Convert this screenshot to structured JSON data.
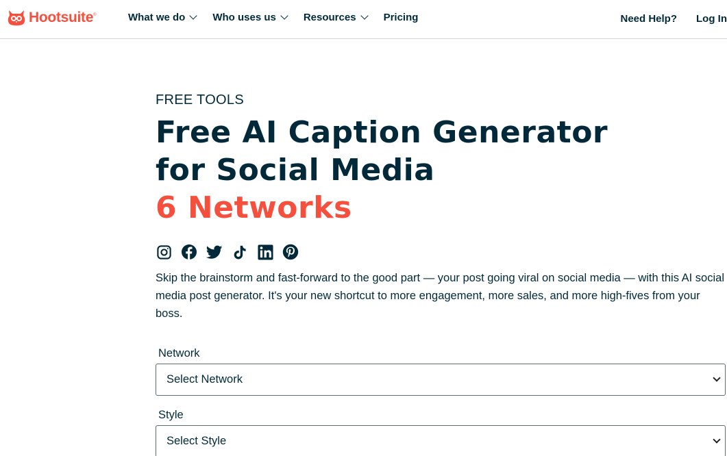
{
  "brand": {
    "name": "Hootsuite",
    "trademark": "®",
    "color": "#f4503d"
  },
  "nav": {
    "items": [
      {
        "label": "What we do",
        "has_dropdown": true
      },
      {
        "label": "Who uses us",
        "has_dropdown": true
      },
      {
        "label": "Resources",
        "has_dropdown": true
      },
      {
        "label": "Pricing",
        "has_dropdown": false
      }
    ],
    "help_label": "Need Help?",
    "login_label": "Log In"
  },
  "hero": {
    "eyebrow": "FREE TOOLS",
    "title_line1": "Free AI Caption Generator",
    "title_line2": "for Social Media",
    "title_accent": "6 Networks",
    "accent_color": "#f4503d",
    "text_color": "#012939",
    "social_icons": [
      "instagram-icon",
      "facebook-icon",
      "twitter-icon",
      "tiktok-icon",
      "linkedin-icon",
      "pinterest-icon"
    ],
    "intro": "Skip the brainstorm and fast-forward to the good part — your post going viral on social media — with this AI social media post generator. It's your new shortcut to more engagement, more sales, and more high-fives from your boss."
  },
  "form": {
    "network": {
      "label": "Network",
      "selected": "Select Network"
    },
    "style": {
      "label": "Style",
      "selected": "Select Style"
    }
  }
}
